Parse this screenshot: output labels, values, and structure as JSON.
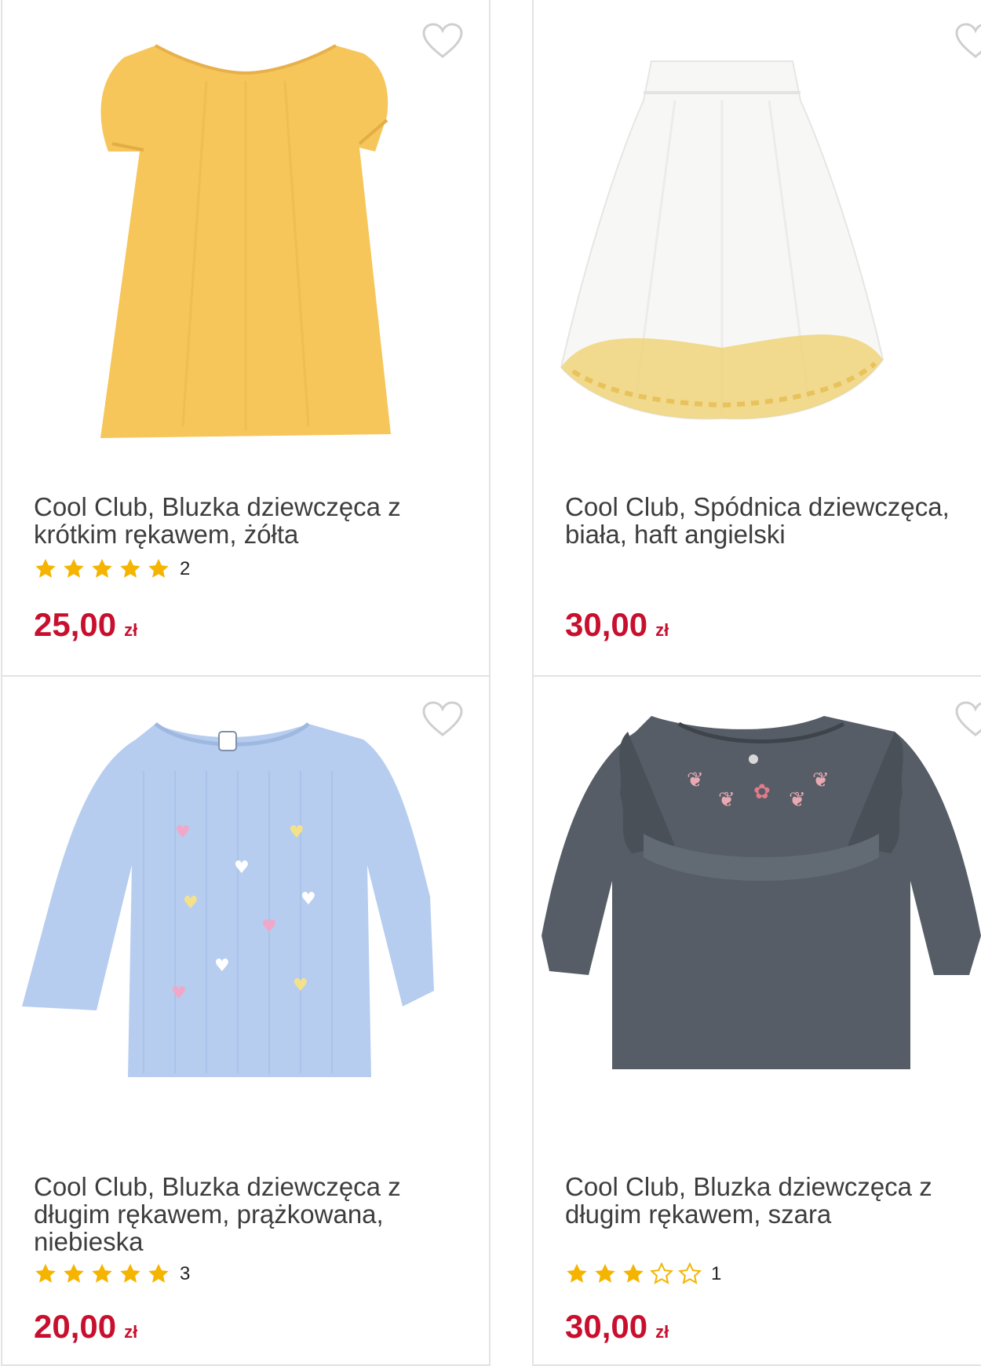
{
  "products": [
    {
      "title": "Cool Club, Bluzka dziewczęca z krótkim rękawem, żółta",
      "rating": 5,
      "rating_count": "2",
      "price": "25,00",
      "currency": "zł",
      "image_icon": "yellow-blouse-image",
      "color": "#f6c65a"
    },
    {
      "title": "Cool Club, Spódnica dziewczęca, biała, haft angielski",
      "rating": null,
      "rating_count": "",
      "price": "30,00",
      "currency": "zł",
      "image_icon": "white-skirt-image",
      "color": "#ffffff"
    },
    {
      "title": "Cool Club, Bluzka dziewczęca z długim rękawem, prążkowana, niebieska",
      "rating": 5,
      "rating_count": "3",
      "price": "20,00",
      "currency": "zł",
      "image_icon": "blue-longsleeve-image",
      "color": "#b6cdef"
    },
    {
      "title": "Cool Club, Bluzka dziewczęca z długim rękawem, szara",
      "rating": 3,
      "rating_count": "1",
      "price": "30,00",
      "currency": "zł",
      "image_icon": "grey-blouse-image",
      "color": "#565d66"
    }
  ],
  "colors": {
    "price": "#c8102e",
    "star": "#f5b400",
    "heart": "#cfcfcf"
  }
}
